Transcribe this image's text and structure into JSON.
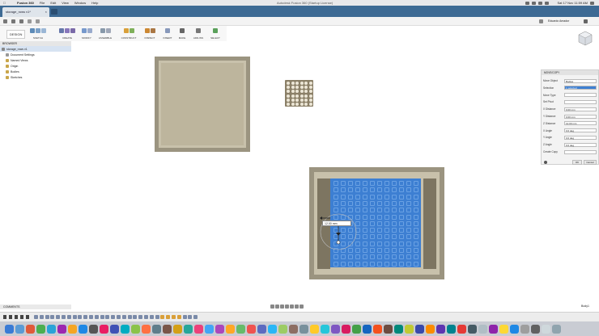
{
  "menubar": {
    "app": "Fusion 360",
    "items": [
      "File",
      "Edit",
      "View",
      "Window",
      "Help"
    ],
    "window_title": "Autodesk Fusion 360 (Startup License)",
    "clock": "Sat 17 Nov 11:59 AM"
  },
  "tab": {
    "title": "storage_rows v1*"
  },
  "topnav": {
    "user": "Eduardo Amador"
  },
  "toolbar": {
    "mode": "DESIGN",
    "groups": [
      "SKETCH",
      "CREATE",
      "MODIFY",
      "ASSEMBLE",
      "CONSTRUCT",
      "INSPECT",
      "INSERT",
      "MAKE",
      "ADD-INS",
      "SELECT"
    ]
  },
  "browser": {
    "title": "BROWSER",
    "items": [
      "storage_rows v1",
      "Document Settings",
      "Named Views",
      "Origin",
      "Bodies",
      "Sketches"
    ]
  },
  "move_panel": {
    "title": "MOVE/COPY",
    "rows": [
      {
        "label": "Move Object",
        "value": "Bodies"
      },
      {
        "label": "Selection",
        "value": "1 selected"
      },
      {
        "label": "Move Type",
        "value": ""
      },
      {
        "label": "Set Pivot",
        "value": ""
      },
      {
        "label": "X Distance",
        "value": "0.00 mm"
      },
      {
        "label": "Y Distance",
        "value": "0.00 mm"
      },
      {
        "label": "Z Distance",
        "value": "12.00 mm"
      },
      {
        "label": "X Angle",
        "value": "0.0 deg"
      },
      {
        "label": "Y Angle",
        "value": "0.0 deg"
      },
      {
        "label": "Z Angle",
        "value": "0.0 deg"
      },
      {
        "label": "Create Copy",
        "value": ""
      }
    ],
    "ok": "OK",
    "cancel": "Cancel"
  },
  "manipulator": {
    "value": "12.00 mm"
  },
  "comments": {
    "label": "COMMENTS"
  },
  "status": {
    "right": "Body1"
  },
  "colors": {
    "accent": "#3d7fd2",
    "tabbar": "#3d6a94",
    "body": "#9b9480"
  }
}
